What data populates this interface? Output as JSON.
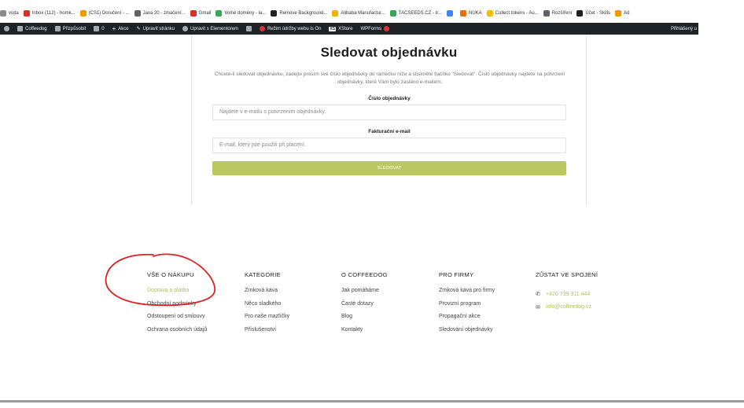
{
  "bookmarks": [
    {
      "label": "vojta",
      "color": "#8c8c8c",
      "icon": "page-icon"
    },
    {
      "label": "Inbox (112) - homk...",
      "color": "#d93025",
      "icon": "gmail-icon"
    },
    {
      "label": "(CS1) Doručení - ...",
      "color": "#f29900",
      "icon": "bookmark-icon"
    },
    {
      "label": "Java 20 - zmačení...",
      "color": "#5f6368",
      "icon": "page-icon"
    },
    {
      "label": "Gmail",
      "color": "#d93025",
      "icon": "gmail-icon"
    },
    {
      "label": "Volné domény - la...",
      "color": "#34a853",
      "icon": "page-icon"
    },
    {
      "label": "Remove Background...",
      "color": "#202124",
      "icon": "page-icon"
    },
    {
      "label": "Alibaba Manufactur...",
      "color": "#f6b100",
      "icon": "page-icon"
    },
    {
      "label": "TACSEEDS.CZ - tr...",
      "color": "#34a853",
      "icon": "page-icon"
    },
    {
      "label": "",
      "color": "#4285f4",
      "icon": "page-icon"
    },
    {
      "label": "NUKA",
      "color": "#e8710a",
      "icon": "page-icon"
    },
    {
      "label": "Collect tokens - Au...",
      "color": "#fbbc04",
      "icon": "page-icon"
    },
    {
      "label": "Rozšíření",
      "color": "#5f6368",
      "icon": "puzzle-icon"
    },
    {
      "label": "Účet - Skills",
      "color": "#202124",
      "icon": "page-icon"
    },
    {
      "label": "Ad",
      "color": "#f29900",
      "icon": "page-icon"
    }
  ],
  "adminbar": {
    "items": [
      {
        "label": "Coffeedog",
        "icon": "home-icon"
      },
      {
        "label": "Přizpůsobit",
        "icon": "brush-icon"
      },
      {
        "label": "0",
        "icon": "comment-icon"
      },
      {
        "label": "Akce",
        "icon": "plus-icon"
      },
      {
        "label": "Upravit stránku",
        "icon": "pencil-icon"
      },
      {
        "label": "Upravit s Elementorem",
        "icon": "elementor-icon"
      },
      {
        "label": "",
        "icon": "yoast-icon"
      },
      {
        "label": "Režim údržby webu is On",
        "icon": "record-icon"
      },
      {
        "label": "XStore",
        "icon": "xstore-icon"
      },
      {
        "label": "WPForms",
        "icon": "wpforms-icon"
      }
    ],
    "right": "Přihlášený u"
  },
  "card": {
    "title": "Sledovat objednávku",
    "description": "Chcete-li sledovat objednávku, zadejte prosím své číslo objednávky do rámečku níže a stiskněte tlačítko \"Sledovat\". Číslo objednávky najdete na potvrzení objednávky, které Vám bylo zasláno e-mailem.",
    "order_label": "Číslo objednávky",
    "order_placeholder": "Najdete v e-mailu s potvrzením objednávky.",
    "email_label": "Fakturační e-mail",
    "email_placeholder": "E-mail, který jste použili při placení.",
    "button": "SLEDOVAT",
    "accent": "#b9c95f"
  },
  "footer": {
    "columns": [
      {
        "heading": "VŠE O NÁKUPU",
        "links": [
          "Doprava a platba",
          "Obchodní podmínky",
          "Odstoupení od smlouvy",
          "Ochrana osobních údajů"
        ]
      },
      {
        "heading": "KATEGORIE",
        "links": [
          "Zrnková káva",
          "Něco sladkého",
          "Pro naše mazlíčky",
          "Příslušenství"
        ]
      },
      {
        "heading": "O COFFEEDOG",
        "links": [
          "Jak pomáháme",
          "Časté dotazy",
          "Blog",
          "Kontakty"
        ]
      },
      {
        "heading": "PRO FIRMY",
        "links": [
          "Zrnková káva pro firmy",
          "Provizní program",
          "Propagační akce",
          "Sledování objednávky"
        ]
      }
    ],
    "contact": {
      "heading": "ZŮSTAT VE SPOJENÍ",
      "phone": "+420 739 311 444",
      "email": "info@coffeedog.cz"
    },
    "accent": "#b3c15a"
  }
}
